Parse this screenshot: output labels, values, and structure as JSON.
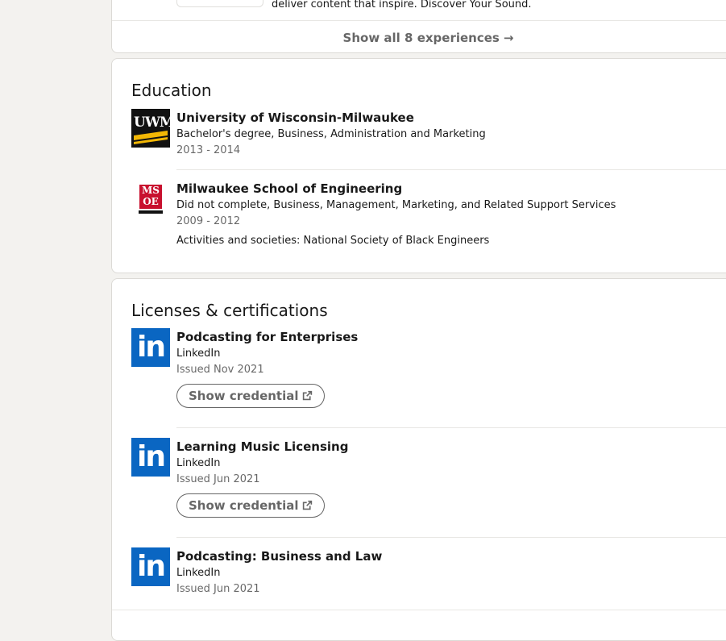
{
  "experience": {
    "snippet": "deliver content that inspire. Discover Your Sound.",
    "show_all_prefix": "Show all ",
    "show_all_count": "8",
    "show_all_suffix": " experiences"
  },
  "education": {
    "title": "Education",
    "items": [
      {
        "school": "University of Wisconsin-Milwaukee",
        "degree": "Bachelor's degree, Business, Administration and Marketing",
        "dates": "2013 - 2014",
        "logo_text": "UWM"
      },
      {
        "school": "Milwaukee School of Engineering",
        "degree": "Did not complete, Business, Management, Marketing, and Related Support Services",
        "dates": "2009 - 2012",
        "activities": "Activities and societies: National Society of Black Engineers",
        "logo_text_top": "MS",
        "logo_text_bottom": "OE"
      }
    ]
  },
  "licenses": {
    "title": "Licenses & certifications",
    "items": [
      {
        "name": "Podcasting for Enterprises",
        "issuer": "LinkedIn",
        "issued": "Issued Nov 2021",
        "button": "Show credential"
      },
      {
        "name": "Learning Music Licensing",
        "issuer": "LinkedIn",
        "issued": "Issued Jun 2021",
        "button": "Show credential"
      },
      {
        "name": "Podcasting: Business and Law",
        "issuer": "LinkedIn",
        "issued": "Issued Jun 2021"
      }
    ],
    "logo_text": "in"
  },
  "colors": {
    "linkedin_blue": "#0a66c2",
    "uwm_gold": "#f2b705",
    "msoe_red": "#c8102e",
    "page_bg": "#f3f2ef"
  }
}
